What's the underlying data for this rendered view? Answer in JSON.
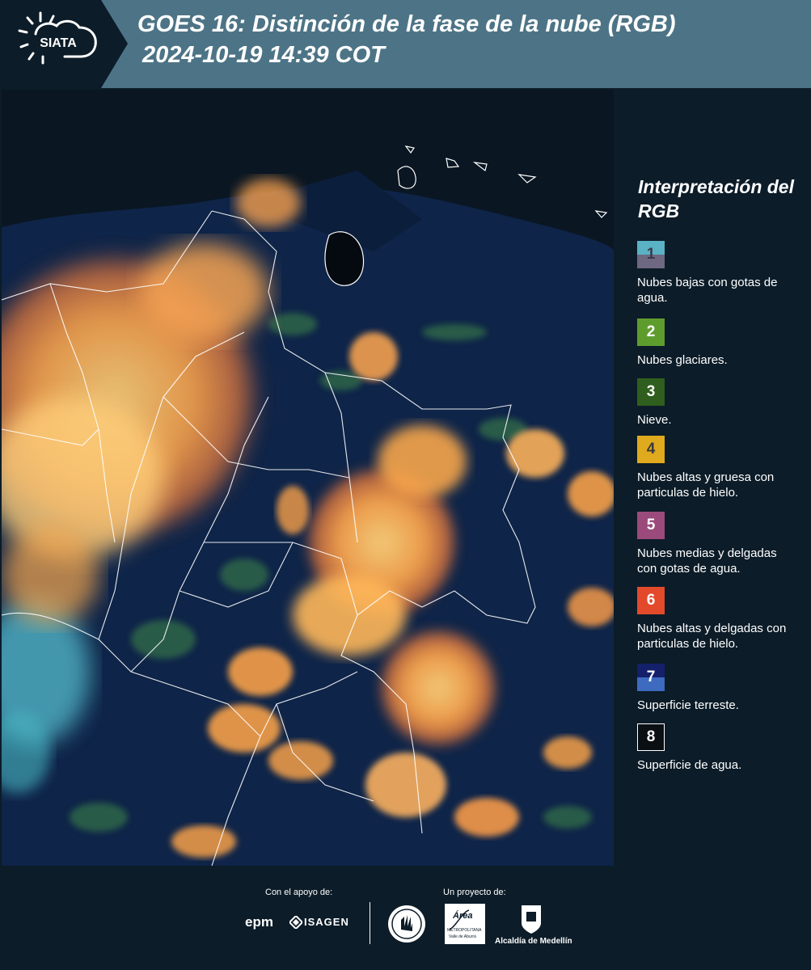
{
  "header": {
    "logo_text": "SIATA",
    "title_line1": "GOES 16: Distinción de la fase de la nube (RGB)",
    "title_line2": "2024-10-19 14:39 COT"
  },
  "legend": {
    "title": "Interpretación del RGB",
    "items": [
      {
        "number": "1",
        "label": "Nubes bajas con gotas de agua.",
        "color_top": "#5ab2c4",
        "color_bottom": "#6e6882",
        "text_color": "#3a3a4a"
      },
      {
        "number": "2",
        "label": "Nubes glaciares.",
        "color": "#5e9c2e",
        "text_color": "#ffffff"
      },
      {
        "number": "3",
        "label": "Nieve.",
        "color": "#2f5e1e",
        "text_color": "#ffffff"
      },
      {
        "number": "4",
        "label": "Nubes altas y gruesa con particulas de hielo.",
        "color": "#e0aa1e",
        "text_color": "#3a3a3a"
      },
      {
        "number": "5",
        "label": "Nubes medias y delgadas con gotas de agua.",
        "color": "#9b4a7c",
        "text_color": "#ffffff"
      },
      {
        "number": "6",
        "label": "Nubes altas y delgadas con particulas de hielo.",
        "color": "#e34a2c",
        "text_color": "#ffffff"
      },
      {
        "number": "7",
        "label": "Superficie terreste.",
        "color_top": "#14206a",
        "color_bottom": "#3e6ac0",
        "text_color": "#ffffff"
      },
      {
        "number": "8",
        "label": "Superficie de agua.",
        "color": "#0a0f14",
        "text_color": "#ffffff"
      }
    ]
  },
  "footer": {
    "support_label": "Con el apoyo de:",
    "project_label": "Un proyecto de:",
    "sponsors": [
      "epm",
      "ISAGEN"
    ],
    "project_logo_texts": [
      "Área",
      "METROPOLITANA",
      "Valle de Aburrá",
      "Alcaldía de Medellín"
    ]
  },
  "colors": {
    "header_bg": "#4d7486",
    "page_bg": "#0c1c28",
    "cloud_orange": "#f59a3c",
    "cloud_yellow": "#ffcc66",
    "land": "#0e2448",
    "ocean": "#0a1622"
  }
}
